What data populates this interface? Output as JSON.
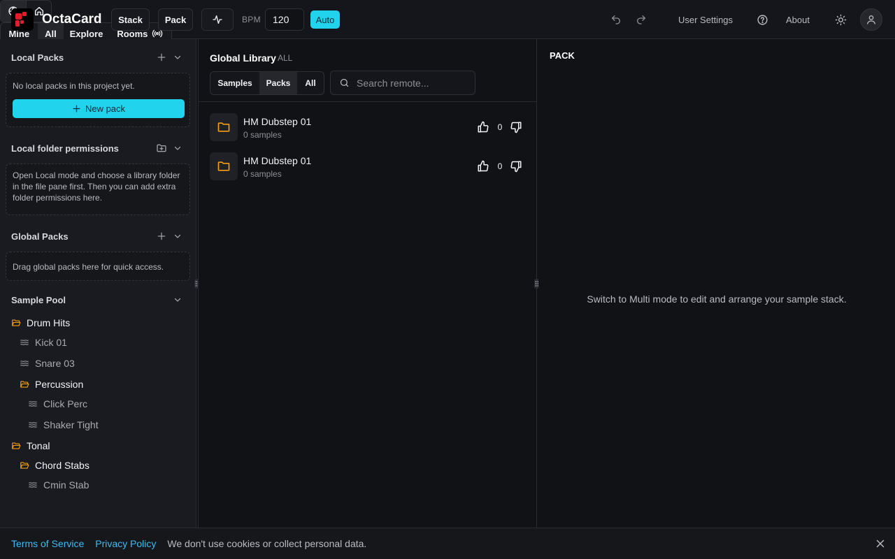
{
  "app": {
    "name": "OctaCard",
    "accent": "#22d3ee"
  },
  "toolbar": {
    "stack_label": "Stack",
    "pack_label": "Pack",
    "bpm_label": "BPM",
    "bpm_value": "120",
    "auto_label": "Auto",
    "scope_tabs": [
      "Mine",
      "All",
      "Explore",
      "Rooms"
    ],
    "active_scope": "All",
    "user_settings_label": "User Settings",
    "about_label": "About"
  },
  "sidebar": {
    "local_packs": {
      "title": "Local Packs",
      "empty_text": "No local packs in this project yet.",
      "new_pack_label": "New pack"
    },
    "folder_permissions": {
      "title": "Local folder permissions",
      "help_text": "Open Local mode and choose a library folder in the file pane first. Then you can add extra folder permissions here."
    },
    "global_packs": {
      "title": "Global Packs",
      "help_text": "Drag global packs here for quick access."
    },
    "sample_pool": {
      "title": "Sample Pool",
      "items": [
        {
          "label": "Drum Hits",
          "type": "folder"
        },
        {
          "label": "Kick 01",
          "type": "sample"
        },
        {
          "label": "Snare 03",
          "type": "sample"
        },
        {
          "label": "Percussion",
          "type": "folder"
        },
        {
          "label": "Click Perc",
          "type": "sample"
        },
        {
          "label": "Shaker Tight",
          "type": "sample"
        },
        {
          "label": "Tonal",
          "type": "folder"
        },
        {
          "label": "Chord Stabs",
          "type": "folder"
        },
        {
          "label": "Cmin Stab",
          "type": "sample"
        }
      ]
    }
  },
  "library": {
    "title": "Global Library",
    "scope": "ALL",
    "tabs": [
      "Samples",
      "Packs",
      "All"
    ],
    "active_tab": "Packs",
    "search_placeholder": "Search remote...",
    "rows": [
      {
        "name": "HM Dubstep 01",
        "count": "0 samples",
        "votes": "0"
      },
      {
        "name": "HM Dubstep 01",
        "count": "0 samples",
        "votes": "0"
      }
    ]
  },
  "pack_panel": {
    "title": "PACK",
    "empty_text": "Switch to Multi mode to edit and arrange your sample stack."
  },
  "footer": {
    "terms_label": "Terms of Service",
    "privacy_label": "Privacy Policy",
    "note": "We don't use cookies or collect personal data."
  }
}
